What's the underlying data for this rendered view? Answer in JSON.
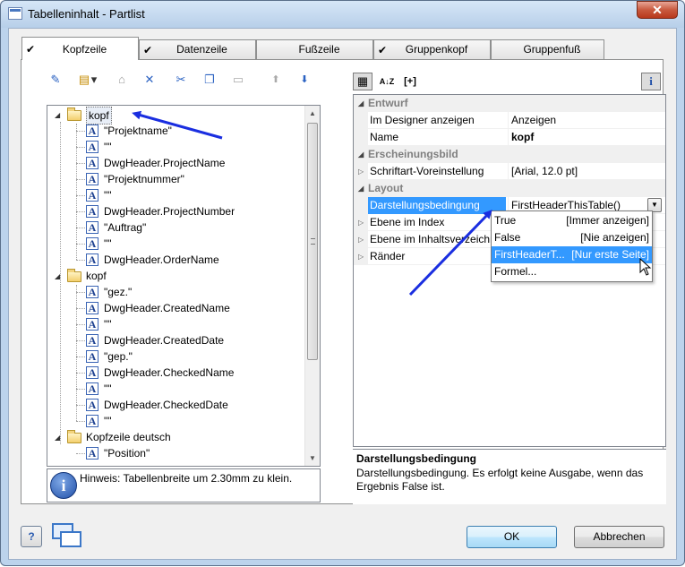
{
  "window": {
    "title": "Tabelleninhalt - Partlist",
    "close_glyph": "✕"
  },
  "tabs": [
    {
      "label": "Kopfzeile",
      "checked": true,
      "active": true
    },
    {
      "label": "Datenzeile",
      "checked": true
    },
    {
      "label": "Fußzeile",
      "checked": false
    },
    {
      "label": "Gruppenkopf",
      "checked": true
    },
    {
      "label": "Gruppenfuß",
      "checked": false
    }
  ],
  "left_toolbar": [
    {
      "name": "wizard-icon",
      "glyph": "✎"
    },
    {
      "name": "new-item-icon",
      "glyph": "▤"
    },
    {
      "name": "dropdown-arrow-icon",
      "glyph": "▾"
    },
    {
      "name": "properties-icon",
      "glyph": "⌂"
    },
    {
      "name": "delete-icon",
      "glyph": "✕"
    },
    {
      "name": "cut-icon",
      "glyph": "✂"
    },
    {
      "name": "copy-icon",
      "glyph": "❐"
    },
    {
      "name": "paste-icon",
      "glyph": "▭"
    },
    {
      "name": "move-up-icon",
      "glyph": "⬆"
    },
    {
      "name": "move-down-icon",
      "glyph": "⬇"
    }
  ],
  "tree": [
    {
      "type": "folder",
      "label": "kopf",
      "selected": true
    },
    {
      "type": "field",
      "label": "\"Projektname\""
    },
    {
      "type": "field",
      "label": "\"\""
    },
    {
      "type": "field",
      "label": "DwgHeader.ProjectName"
    },
    {
      "type": "field",
      "label": "\"Projektnummer\""
    },
    {
      "type": "field",
      "label": "\"\""
    },
    {
      "type": "field",
      "label": "DwgHeader.ProjectNumber"
    },
    {
      "type": "field",
      "label": "\"Auftrag\""
    },
    {
      "type": "field",
      "label": "\"\""
    },
    {
      "type": "field",
      "label": "DwgHeader.OrderName"
    },
    {
      "type": "folder",
      "label": "kopf"
    },
    {
      "type": "field",
      "label": "\"gez.\""
    },
    {
      "type": "field",
      "label": "DwgHeader.CreatedName"
    },
    {
      "type": "field",
      "label": "\"\""
    },
    {
      "type": "field",
      "label": "DwgHeader.CreatedDate"
    },
    {
      "type": "field",
      "label": "\"gep.\""
    },
    {
      "type": "field",
      "label": "DwgHeader.CheckedName"
    },
    {
      "type": "field",
      "label": "\"\""
    },
    {
      "type": "field",
      "label": "DwgHeader.CheckedDate"
    },
    {
      "type": "field",
      "label": "\"\""
    },
    {
      "type": "folder",
      "label": "Kopfzeile deutsch"
    },
    {
      "type": "field",
      "label": "\"Position\""
    }
  ],
  "field_glyph": "A",
  "hint": {
    "icon_glyph": "i",
    "text": "Hinweis: Tabellenbreite um 2.30mm zu klein."
  },
  "right_toolbar": [
    {
      "name": "categorized-view-icon",
      "glyph": "▦",
      "pressed": true
    },
    {
      "name": "sort-alpha-icon",
      "glyph": "A↓Z"
    },
    {
      "name": "expand-all-icon",
      "glyph": "[+]"
    },
    {
      "name": "info-toggle-icon",
      "glyph": "i",
      "pressed": true
    }
  ],
  "properties": {
    "categories": [
      {
        "name": "Entwurf",
        "rows": [
          {
            "name": "Im Designer anzeigen",
            "value": "Anzeigen"
          },
          {
            "name": "Name",
            "value": "kopf",
            "bold": true
          }
        ]
      },
      {
        "name": "Erscheinungsbild",
        "rows": [
          {
            "name": "Schriftart-Voreinstellung",
            "value": "[Arial, 12.0 pt]",
            "expandable": true
          }
        ]
      },
      {
        "name": "Layout",
        "rows": [
          {
            "name": "Darstellungsbedingung",
            "value": "FirstHeaderThisTable()",
            "selected": true,
            "combo": true
          },
          {
            "name": "Ebene im Index",
            "value": "",
            "expandable": true
          },
          {
            "name": "Ebene im Inhaltsverzeichnis",
            "value": "",
            "expandable": true
          },
          {
            "name": "Ränder",
            "value": "",
            "expandable": true
          }
        ]
      }
    ]
  },
  "dropdown": [
    {
      "left": "True",
      "right": "[Immer anzeigen]"
    },
    {
      "left": "False",
      "right": "[Nie anzeigen]"
    },
    {
      "left": "FirstHeaderT...",
      "right": "[Nur erste Seite]",
      "highlighted": true
    },
    {
      "left": "Formel...",
      "right": ""
    }
  ],
  "description": {
    "title": "Darstellungsbedingung",
    "text": "Darstellungsbedingung. Es erfolgt keine Ausgabe, wenn das Ergebnis False ist."
  },
  "buttons": {
    "help_glyph": "?",
    "ok": "OK",
    "cancel": "Abbrechen"
  },
  "colors": {
    "accent_selection": "#3399ff",
    "arrow_annotation": "#1a2ee0",
    "titlebar": "#bcd3ec"
  }
}
